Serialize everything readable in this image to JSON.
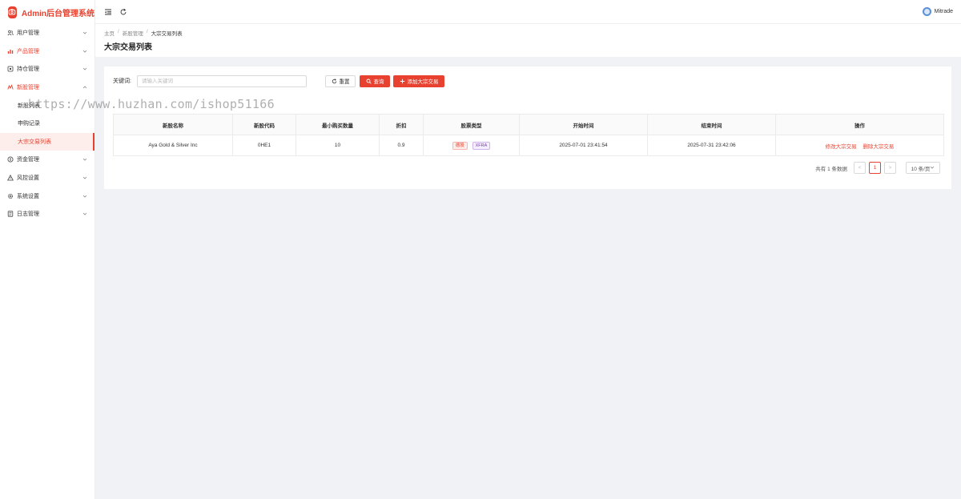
{
  "app": {
    "title": "Admin后台管理系统"
  },
  "sidebar": {
    "items": [
      {
        "label": "用户管理",
        "icon": "users-icon",
        "expanded": false,
        "red": false
      },
      {
        "label": "产品管理",
        "icon": "chart-icon",
        "expanded": false,
        "red": true
      },
      {
        "label": "持仓管理",
        "icon": "wallet-icon",
        "expanded": false,
        "red": false
      },
      {
        "label": "新股管理",
        "icon": "ipo-icon",
        "expanded": true,
        "red": true
      },
      {
        "label": "资金管理",
        "icon": "coin-icon",
        "expanded": false,
        "red": false
      },
      {
        "label": "风控设置",
        "icon": "warning-icon",
        "expanded": false,
        "red": false
      },
      {
        "label": "系统设置",
        "icon": "gear-icon",
        "expanded": false,
        "red": false
      },
      {
        "label": "日志管理",
        "icon": "log-icon",
        "expanded": false,
        "red": false
      }
    ],
    "submenu": [
      {
        "label": "新股列表",
        "active": false
      },
      {
        "label": "申购记录",
        "active": false
      },
      {
        "label": "大宗交易列表",
        "active": true
      }
    ]
  },
  "topbar": {
    "user": "Mitrade"
  },
  "breadcrumb": {
    "home": "主页",
    "parent": "新股管理",
    "current": "大宗交易列表"
  },
  "page": {
    "title": "大宗交易列表"
  },
  "search": {
    "label": "关键词:",
    "placeholder": "请输入关键词",
    "value": "",
    "reset": "重置",
    "query": "查询",
    "add": "添加大宗交易"
  },
  "table": {
    "headers": [
      "新股名称",
      "新股代码",
      "最小购买数量",
      "折扣",
      "股票类型",
      "开始时间",
      "结束时间",
      "操作"
    ],
    "rows": [
      {
        "name": "Aya Gold & Silver Inc",
        "code": "0HE1",
        "min_qty": "10",
        "discount": "0.9",
        "tags": [
          "德股",
          "XFRA"
        ],
        "start": "2025-07-01 23:41:54",
        "end": "2025-07-31 23:42:06",
        "actions": [
          "修改大宗交易",
          "删除大宗交易"
        ]
      }
    ]
  },
  "pagination": {
    "total_text": "共有 1 条数据",
    "prev": "<",
    "current": "1",
    "next": ">",
    "page_size": "10 条/页"
  },
  "watermark": "https://www.huzhan.com/ishop51166",
  "colors": {
    "accent": "#e8412f",
    "tag_purple": "#7b3fb8"
  }
}
